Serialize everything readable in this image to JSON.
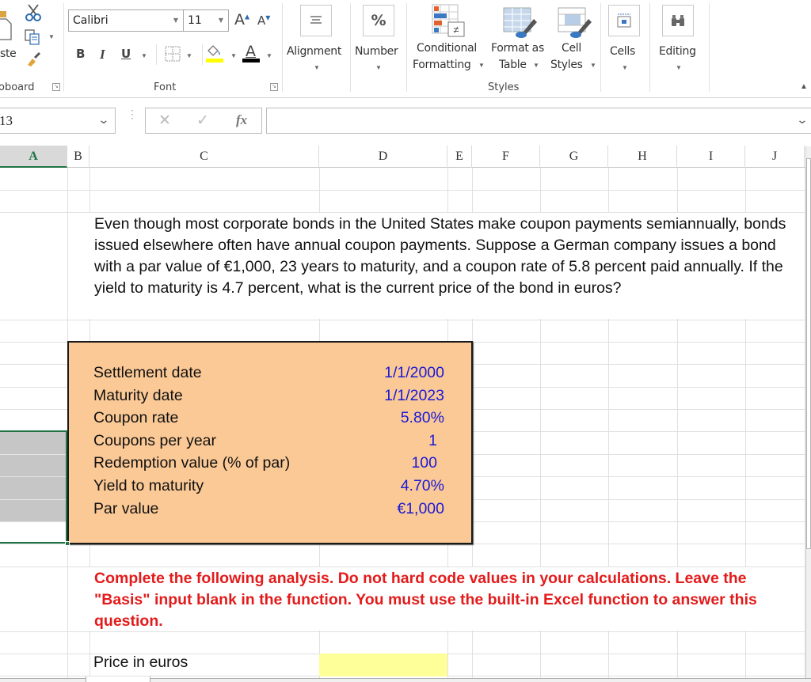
{
  "ribbon": {
    "clipboard": {
      "paste_label": "ste",
      "group_label": "oboard",
      "icons": [
        "paste-icon",
        "cut-icon",
        "copy-icon",
        "format-painter-icon"
      ]
    },
    "font": {
      "font_name": "Calibri",
      "font_size": "11",
      "grow_label": "A",
      "shrink_label": "A",
      "bold_label": "B",
      "italic_label": "I",
      "underline_label": "U",
      "fill_color": "#ffff00",
      "font_color": "#000000",
      "group_label": "Font"
    },
    "alignment_label": "Alignment",
    "number_label": "Number",
    "number_icon_glyph": "%",
    "styles": {
      "conditional_formatting": [
        "Conditional",
        "Formatting"
      ],
      "format_as_table": [
        "Format as",
        "Table"
      ],
      "cell_styles": [
        "Cell",
        "Styles"
      ],
      "group_label": "Styles"
    },
    "cells_label": "Cells",
    "editing_label": "Editing"
  },
  "formula_bar": {
    "name_box": "13",
    "cancel_glyph": "✕",
    "enter_glyph": "✓",
    "fx_label": "fx",
    "formula_value": ""
  },
  "grid": {
    "columns": [
      "A",
      "B",
      "C",
      "D",
      "E",
      "F",
      "G",
      "H",
      "I",
      "J"
    ],
    "selected_column": "A"
  },
  "problem_text": "Even though most corporate bonds in the United States make coupon payments semiannually, bonds issued elsewhere often have annual coupon payments. Suppose a German company issues a bond with a par value of €1,000, 23 years to maturity, and a coupon rate of 5.8 percent paid annually. If the yield to maturity is 4.7 percent, what is the current price of the bond in euros?",
  "inputs": [
    {
      "label": "Settlement date",
      "value": "1/1/2000"
    },
    {
      "label": "Maturity date",
      "value": "1/1/2023"
    },
    {
      "label": "Coupon rate",
      "value": "5.80%"
    },
    {
      "label": "Coupons per year",
      "value": "1"
    },
    {
      "label": "Redemption value (% of par)",
      "value": "100"
    },
    {
      "label": "Yield to maturity",
      "value": "4.70%"
    },
    {
      "label": "Par value",
      "value": "€1,000"
    }
  ],
  "instructions": "Complete the following analysis. Do not hard code values in your calculations. Leave the \"Basis\" input blank in the function. You must use the built-in Excel function to answer this question.",
  "output": {
    "label": "Price in euros",
    "value": ""
  },
  "colors": {
    "input_box_fill": "#fbc996",
    "input_value_color": "#1a1ad6",
    "instruction_color": "#e31b1b",
    "answer_cell_fill": "#ffff99",
    "selection_color": "#217346"
  }
}
